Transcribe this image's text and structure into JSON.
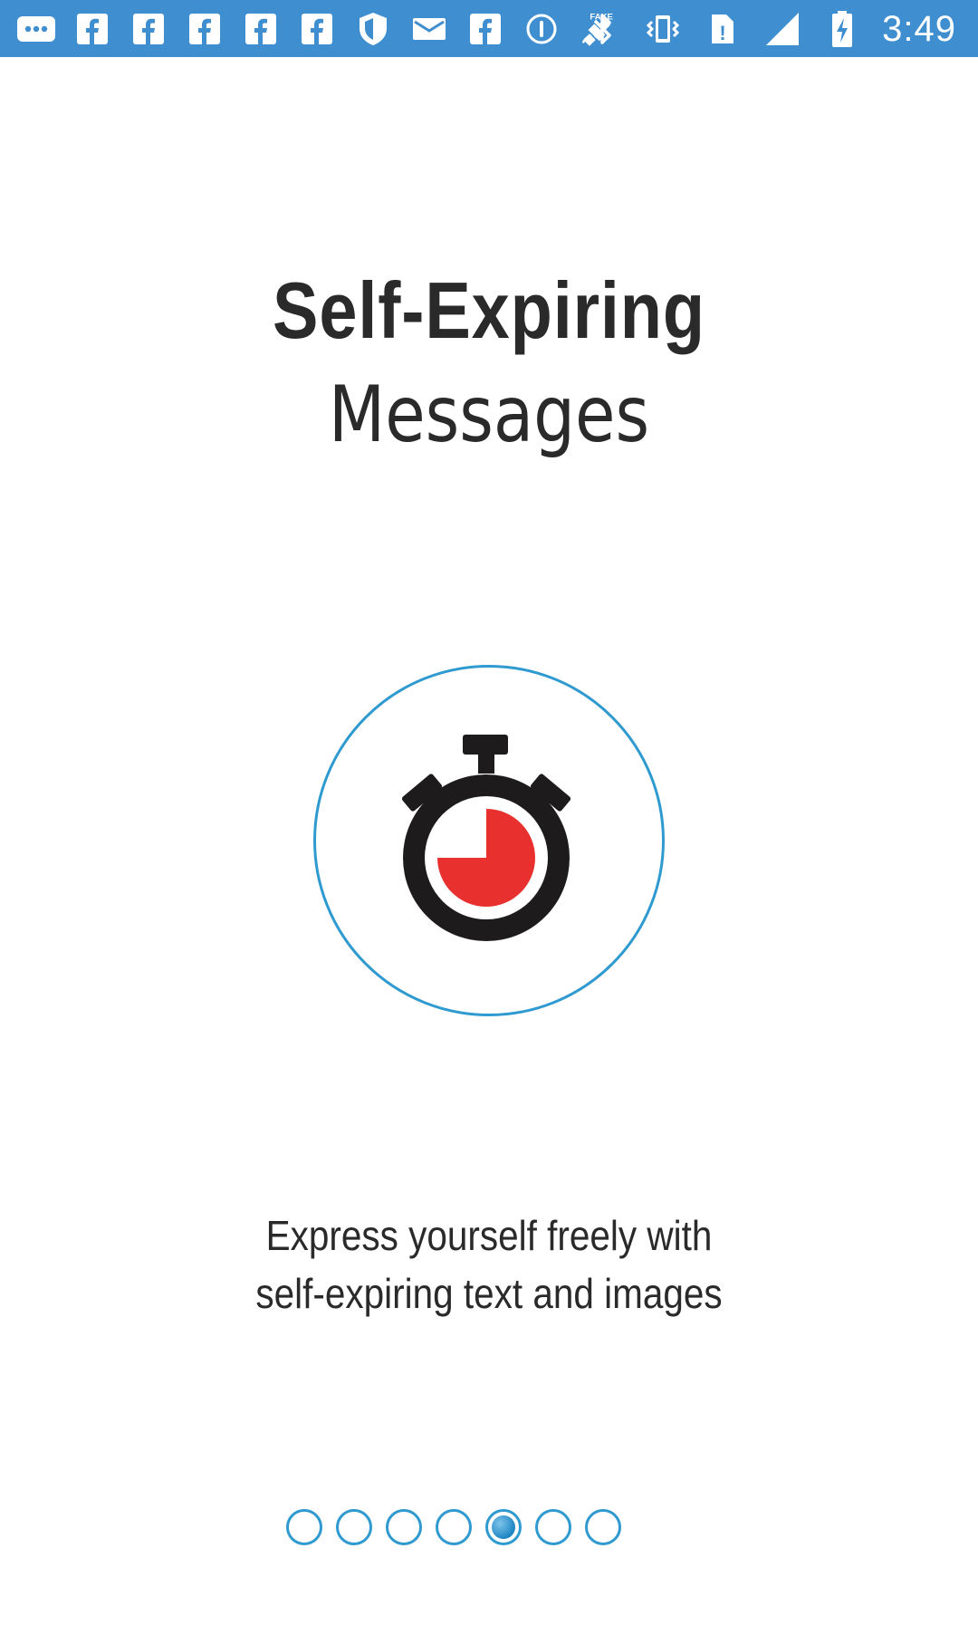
{
  "status_bar": {
    "time": "3:49",
    "left_icons": [
      "more-dots-icon",
      "facebook-icon",
      "facebook-icon",
      "facebook-icon",
      "facebook-icon",
      "facebook-icon",
      "shield-icon",
      "mail-icon",
      "facebook-icon",
      "info-circle-icon",
      "fake-gps-icon"
    ],
    "right_icons": [
      "bluetooth-icon",
      "vibrate-icon",
      "no-sim-icon",
      "signal-icon",
      "battery-charging-icon"
    ],
    "background_color": "#3f8ed0"
  },
  "onboarding": {
    "title_bold": "Self-Expiring",
    "title_light": "Messages",
    "description_line1": "Express yourself freely with",
    "description_line2": "self-expiring text and images",
    "illustration": "stopwatch-icon",
    "accent_color": "#2f9ad0",
    "timer_fill_color": "#e8312f"
  },
  "pager": {
    "total_pages": 7,
    "current_page": 5
  }
}
